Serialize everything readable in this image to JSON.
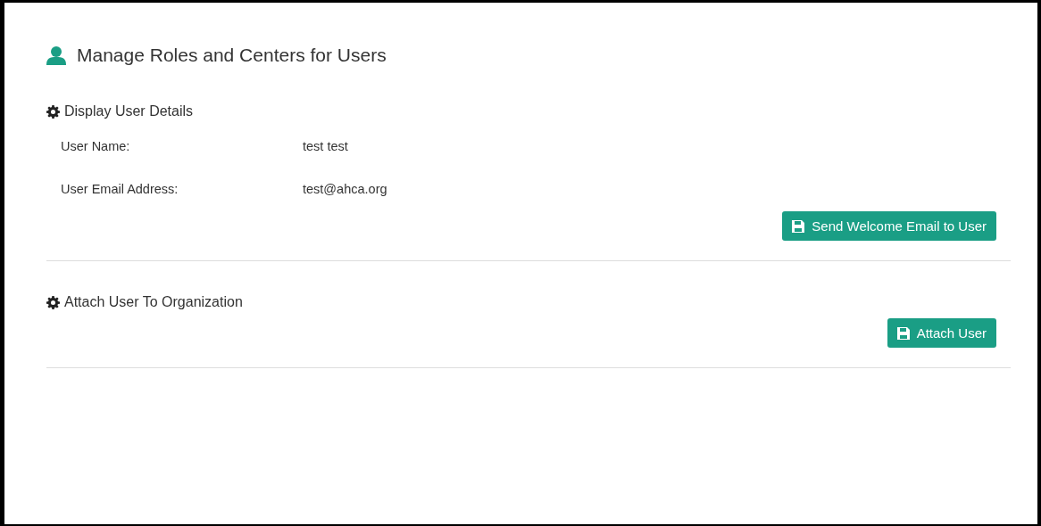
{
  "page": {
    "title": "Manage Roles and Centers for Users"
  },
  "sections": [
    {
      "heading": "Display User Details",
      "fields": [
        {
          "label": "User Name:",
          "value": "test test"
        },
        {
          "label": "User Email Address:",
          "value": "test@ahca.org"
        }
      ],
      "button": "Send Welcome Email to User"
    },
    {
      "heading": "Attach User To Organization",
      "button": "Attach User"
    }
  ]
}
